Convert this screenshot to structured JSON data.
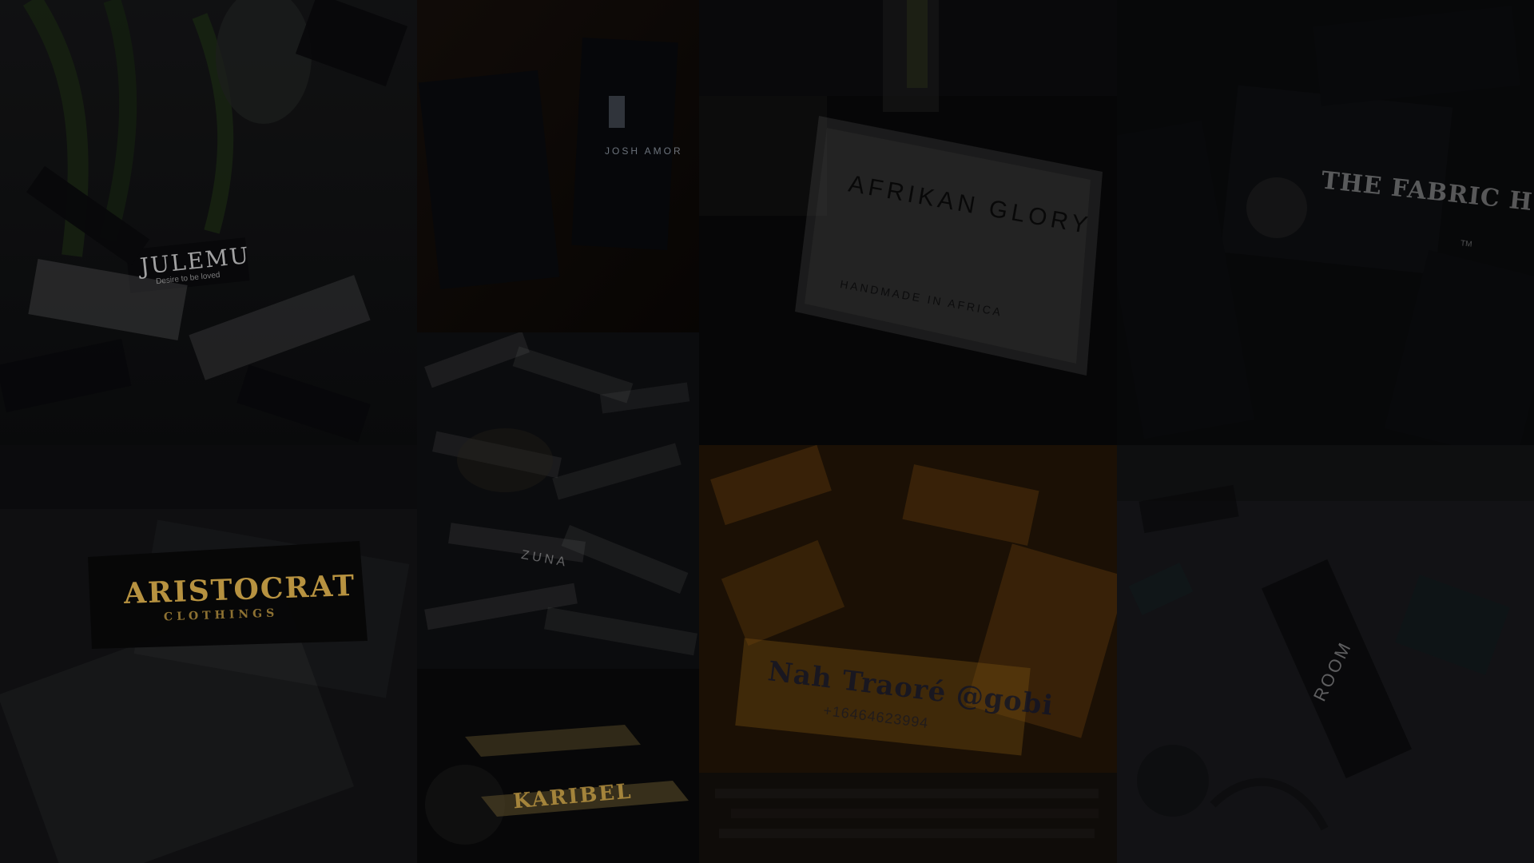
{
  "collage": {
    "tiles": [
      {
        "id": "t1",
        "label": "JULEMU",
        "sublabel": "Desire to be loved"
      },
      {
        "id": "t2",
        "label": "JOSH AMOR"
      },
      {
        "id": "t3",
        "label": "ZUNA"
      },
      {
        "id": "t4",
        "label": "KARIBEL"
      },
      {
        "id": "t5",
        "label": "AFRIKAN GLORY",
        "sublabel": "HANDMADE IN AFRICA"
      },
      {
        "id": "t6",
        "label": "THE FABRIC HUB",
        "sublabel": "TM"
      },
      {
        "id": "t7",
        "label": "ARISTOCRAT",
        "sublabel": "CLOTHINGS"
      },
      {
        "id": "t8",
        "label": "Nah Traoré @gobi",
        "sublabel": "+16464623994"
      },
      {
        "id": "t9",
        "label": "ROOM"
      }
    ],
    "colors": {
      "background": "#07080a",
      "label_white": "#ffffff",
      "label_black": "#0f0f12",
      "gold": "#d6aa4a",
      "orange": "#e08a1a"
    }
  }
}
